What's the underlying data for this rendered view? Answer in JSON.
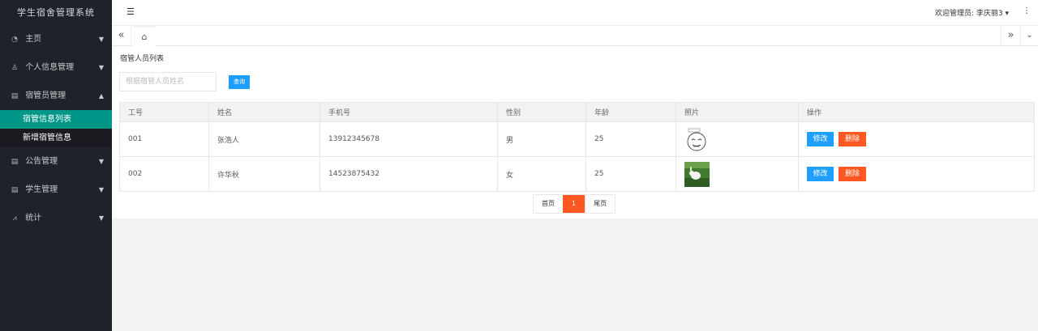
{
  "app_title": "学生宿舍管理系统",
  "sidebar": {
    "items": [
      {
        "label": "主页",
        "icon": "dashboard-icon"
      },
      {
        "label": "个人信息管理",
        "icon": "user-icon"
      },
      {
        "label": "宿管员管理",
        "icon": "list-icon",
        "expanded": true,
        "children": [
          {
            "label": "宿管信息列表",
            "active": true
          },
          {
            "label": "新增宿管信息"
          }
        ]
      },
      {
        "label": "公告管理",
        "icon": "notice-icon"
      },
      {
        "label": "学生管理",
        "icon": "student-icon"
      },
      {
        "label": "统计",
        "icon": "chart-icon"
      }
    ]
  },
  "header": {
    "admin_text": "欢迎管理员: 李庆丽3"
  },
  "page": {
    "title": "宿管人员列表",
    "search_placeholder": "根据宿管人员姓名",
    "search_button": "查询"
  },
  "table": {
    "columns": [
      "工号",
      "姓名",
      "手机号",
      "性别",
      "年龄",
      "照片",
      "操作"
    ],
    "rows": [
      {
        "id": "001",
        "name": "张浩人",
        "phone": "13912345678",
        "gender": "男",
        "age": "25",
        "photo": "cartoon-face-photo",
        "edit": "修改",
        "delete": "删除"
      },
      {
        "id": "002",
        "name": "许华秋",
        "phone": "14523875432",
        "gender": "女",
        "age": "25",
        "photo": "rabbit-photo",
        "edit": "修改",
        "delete": "删除"
      }
    ]
  },
  "pager": {
    "first": "首页",
    "current": "1",
    "last": "尾页"
  },
  "colors": {
    "sidebar_bg": "#20222a",
    "active": "#009688",
    "primary": "#1e9fff",
    "danger": "#ff5722"
  }
}
